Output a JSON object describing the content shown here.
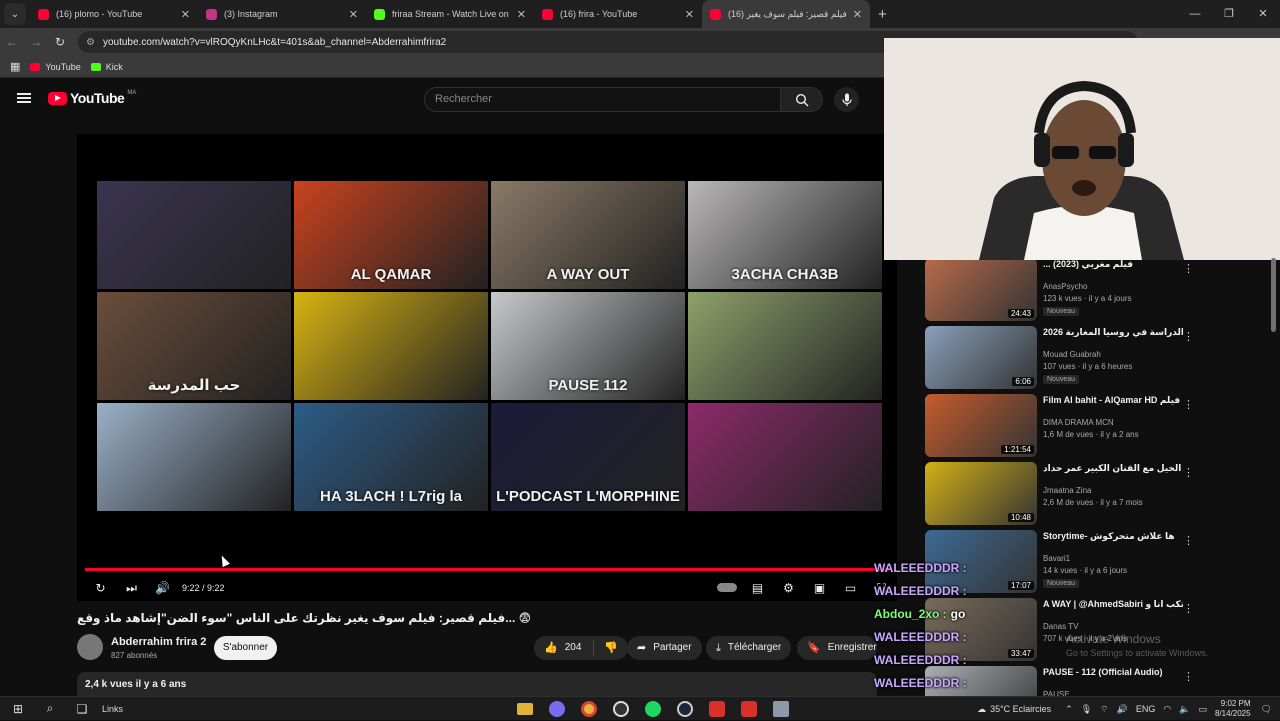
{
  "tabs": [
    {
      "title": "(16) plomo - YouTube",
      "color": "#ff0033"
    },
    {
      "title": "(3) Instagram",
      "color": "#c13584"
    },
    {
      "title": "friraa Stream - Watch Live on Kick",
      "color": "#53fc18"
    },
    {
      "title": "(16) frira - YouTube",
      "color": "#ff0033"
    },
    {
      "title": "(16) فيلم قصير: فيلم سوف يغير",
      "color": "#ff0033"
    }
  ],
  "url": "youtube.com/watch?v=vlROQyKnLHc&t=401s&ab_channel=Abderrahimfrira2",
  "bookmarks": [
    "YouTube",
    "Kick"
  ],
  "youtube": {
    "logo": "YouTube",
    "country": "MA",
    "search_placeholder": "Rechercher"
  },
  "player": {
    "time": "9:22 / 9:22",
    "thumbs": [
      {
        "caption": "",
        "bg": "#3a3450"
      },
      {
        "caption": "AL QAMAR",
        "bg": "#c9421e"
      },
      {
        "caption": "A WAY OUT",
        "bg": "#8a7a66"
      },
      {
        "caption": "3ACHA CHA3B",
        "bg": "#b9b7b8"
      },
      {
        "caption": "حب المدرسة",
        "bg": "#6b4d3a"
      },
      {
        "caption": "",
        "bg": "#d8b312"
      },
      {
        "caption": "PAUSE 112",
        "bg": "#c7c9cb"
      },
      {
        "caption": "",
        "bg": "#8fa16b"
      },
      {
        "caption": "",
        "bg": "#9ab0c8"
      },
      {
        "caption": "HA 3LACH ! L7rig la",
        "bg": "#2e5c86"
      },
      {
        "caption": "L'PODCAST L'MORPHINE",
        "bg": "#1b1b3b"
      },
      {
        "caption": "",
        "bg": "#8c2a6a"
      }
    ]
  },
  "video": {
    "title": "فيلم قصير: فيلم سوف يغير نظرتك على الناس \"سوء الضن\"إشاهد ماذ وقع... 😨",
    "channel": "Abderrahim frira 2",
    "subscribers": "827 abonnés",
    "subscribe_label": "S'abonner",
    "likes": "204",
    "share": "Partager",
    "download": "Télécharger",
    "save": "Enregistrer",
    "views_time": "2,4 k vues  il y a 6 ans"
  },
  "recommendations": [
    {
      "title": "... (2023) فيلم مغربي",
      "channel": "AnasPsycho",
      "meta": "123 k vues · il y a 4 jours",
      "badge": "Nouveau",
      "duration": "24:43",
      "bg": "#b86a4a"
    },
    {
      "title": "الدراسة في روسيا المغاربة 2026",
      "channel": "Mouad Guabrah",
      "meta": "107 vues · il y a 6 heures",
      "badge": "Nouveau",
      "duration": "6:06",
      "bg": "#8aa0bb"
    },
    {
      "title": "Film Al bahit - AlQamar HD فيلم",
      "channel": "DIMA DRAMA MCN",
      "meta": "1,6 M de vues · il y a 2 ans",
      "badge": "",
      "duration": "1:21:54",
      "bg": "#c65c2e"
    },
    {
      "title": "عجلة ركوب الخيل مع الفنان الكبير عمر حداد",
      "channel": "Jmaatna Zina",
      "meta": "2,6 M de vues · il y a 7 mois",
      "badge": "",
      "duration": "10:48",
      "bg": "#d4b018"
    },
    {
      "title": "Storytime- ها علاش متحركوش",
      "channel": "Bavari1",
      "meta": "14 k vues · il y a 6 jours",
      "badge": "Nouveau",
      "duration": "17:07",
      "bg": "#3d6a95"
    },
    {
      "title": "A WAY | @AhmedSabiri كتكب انا و",
      "channel": "Danas TV",
      "meta": "707 k vues · il y a 2 ans",
      "badge": "",
      "duration": "33:47",
      "bg": "#7a6b5a"
    },
    {
      "title": "PAUSE - 112 (Official Audio)",
      "channel": "PAUSE",
      "meta": "10 M de vues · il y a 8 mois",
      "badge": "",
      "duration": "",
      "bg": "#aab0b5"
    }
  ],
  "chat": [
    {
      "user": "WALEEEDDDR :",
      "text": "",
      "color": "#c9a7ff"
    },
    {
      "user": "WALEEEDDDR :",
      "text": "",
      "color": "#c9a7ff"
    },
    {
      "user": "Abdou_2xo :",
      "text": "go",
      "color": "#7dff7a"
    },
    {
      "user": "WALEEEDDDR :",
      "text": "",
      "color": "#c9a7ff"
    },
    {
      "user": "WALEEEDDDR :",
      "text": "",
      "color": "#c9a7ff"
    },
    {
      "user": "WALEEEDDDR :",
      "text": "",
      "color": "#c9a7ff"
    },
    {
      "user": "Abdou_2xo :",
      "text": "",
      "color": "#7dff7a"
    }
  ],
  "watermark": {
    "line1": "Activate Windows",
    "line2": "Go to Settings to activate Windows."
  },
  "taskbar": {
    "links": "Links",
    "weather": "35°C  Eclaircies",
    "lang": "ENG",
    "time": "9:02 PM",
    "date": "8/14/2025"
  }
}
